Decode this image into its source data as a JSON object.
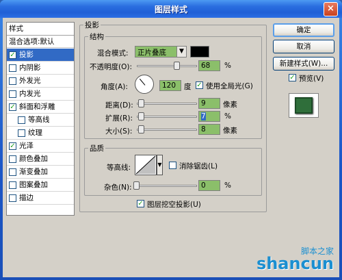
{
  "window": {
    "title": "图层样式",
    "close": "×"
  },
  "styles": {
    "header": "样式",
    "blend_options": "混合选项:默认",
    "items": [
      {
        "label": "投影",
        "checked": true
      },
      {
        "label": "内阴影",
        "checked": false
      },
      {
        "label": "外发光",
        "checked": false
      },
      {
        "label": "内发光",
        "checked": false
      },
      {
        "label": "斜面和浮雕",
        "checked": true
      },
      {
        "label": "等高线",
        "checked": false
      },
      {
        "label": "纹理",
        "checked": false
      },
      {
        "label": "光泽",
        "checked": true
      },
      {
        "label": "颜色叠加",
        "checked": false
      },
      {
        "label": "渐变叠加",
        "checked": false
      },
      {
        "label": "图案叠加",
        "checked": false
      },
      {
        "label": "描边",
        "checked": false
      }
    ]
  },
  "drop_shadow": {
    "title": "投影",
    "structure": {
      "title": "结构",
      "blend_mode_label": "混合模式:",
      "blend_mode": "正片叠底",
      "color": "#000000",
      "opacity_label": "不透明度(O):",
      "opacity": "68",
      "opacity_unit": "%",
      "angle_label": "角度(A):",
      "angle": "120",
      "angle_unit": "度",
      "global_light_label": "使用全局光(G)",
      "global_light": true,
      "distance_label": "距离(D):",
      "distance": "9",
      "distance_unit": "像素",
      "spread_label": "扩展(R):",
      "spread": "7",
      "spread_unit": "%",
      "size_label": "大小(S):",
      "size": "8",
      "size_unit": "像素"
    },
    "quality": {
      "title": "品质",
      "contour_label": "等高线:",
      "anti_alias_label": "消除锯齿(L)",
      "anti_alias": false,
      "noise_label": "杂色(N):",
      "noise": "0",
      "noise_unit": "%"
    },
    "knockout_label": "图层挖空投影(U)",
    "knockout": true
  },
  "buttons": {
    "ok": "确定",
    "cancel": "取消",
    "new_style": "新建样式(W)...",
    "preview_label": "预览(V)",
    "preview": true
  },
  "watermark": {
    "line1": "脚本之家",
    "line2": "shancun"
  },
  "colors": {
    "field_green": "#8bbf6a",
    "selection": "#316ac5",
    "titlebar": "#2b6fe0"
  }
}
